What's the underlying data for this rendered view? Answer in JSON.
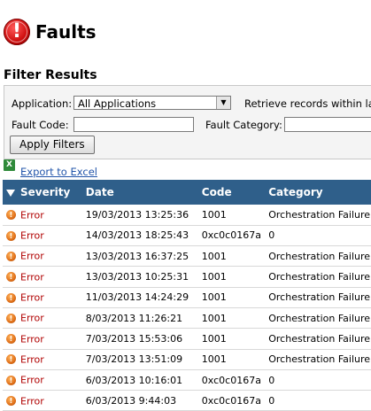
{
  "header": {
    "title": "Faults",
    "icon": "fault-exclamation-icon"
  },
  "filter": {
    "section_title": "Filter Results",
    "application_label": "Application:",
    "application_value": "All Applications",
    "retrieve_label": "Retrieve records within last",
    "fault_code_label": "Fault Code:",
    "fault_code_value": "",
    "fault_category_label": "Fault Category:",
    "fault_category_value": "",
    "apply_button": "Apply Filters"
  },
  "export": {
    "label": "Export to Excel",
    "icon": "excel-icon"
  },
  "table": {
    "columns": [
      "Severity",
      "Date",
      "Code",
      "Category"
    ],
    "rows": [
      {
        "severity": "Error",
        "date": "19/03/2013 13:25:36",
        "code": "1001",
        "category": "Orchestration Failure"
      },
      {
        "severity": "Error",
        "date": "14/03/2013 18:25:43",
        "code": "0xc0c0167a",
        "category": "0"
      },
      {
        "severity": "Error",
        "date": "13/03/2013 16:37:25",
        "code": "1001",
        "category": "Orchestration Failure"
      },
      {
        "severity": "Error",
        "date": "13/03/2013 10:25:31",
        "code": "1001",
        "category": "Orchestration Failure"
      },
      {
        "severity": "Error",
        "date": "11/03/2013 14:24:29",
        "code": "1001",
        "category": "Orchestration Failure"
      },
      {
        "severity": "Error",
        "date": "8/03/2013 11:26:21",
        "code": "1001",
        "category": "Orchestration Failure"
      },
      {
        "severity": "Error",
        "date": "7/03/2013 15:53:06",
        "code": "1001",
        "category": "Orchestration Failure"
      },
      {
        "severity": "Error",
        "date": "7/03/2013 13:51:09",
        "code": "1001",
        "category": "Orchestration Failure"
      },
      {
        "severity": "Error",
        "date": "6/03/2013 10:16:01",
        "code": "0xc0c0167a",
        "category": "0"
      },
      {
        "severity": "Error",
        "date": "6/03/2013 9:44:03",
        "code": "0xc0c0167a",
        "category": "0"
      }
    ]
  },
  "colors": {
    "header_bar": "#2f5f8a",
    "error_text": "#b00000",
    "link": "#2255aa"
  }
}
